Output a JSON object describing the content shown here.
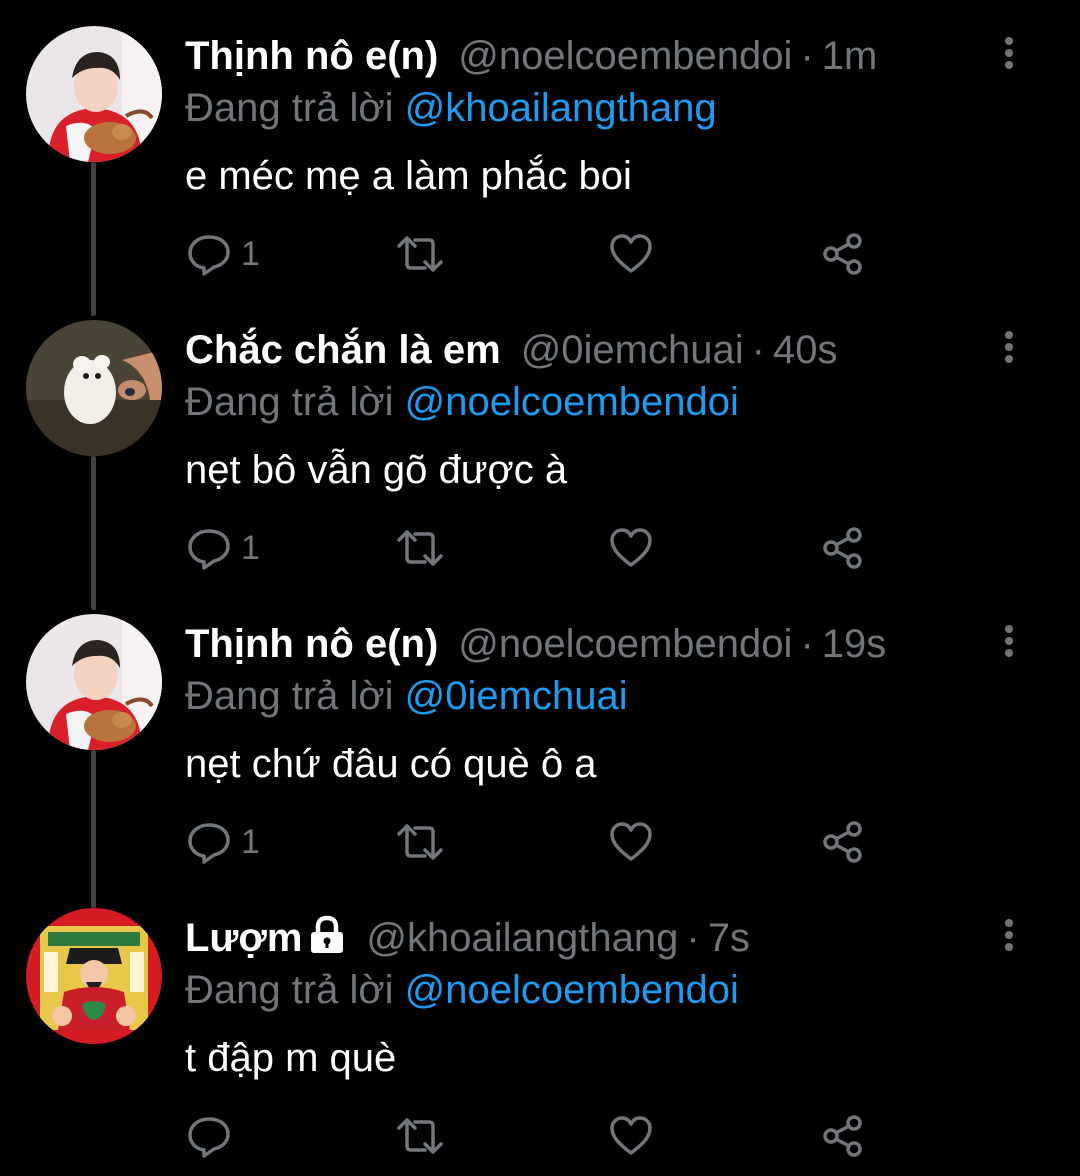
{
  "tweets": [
    {
      "display_name": "Thịnh nô e(n)",
      "handle": "@noelcoembendoi",
      "separator": "·",
      "time": "1m",
      "reply_prefix": "Đang trả lời",
      "reply_to": "@khoailangthang",
      "text": "e méc mẹ a làm phắc boi",
      "reply_count": "1",
      "avatar": "avatar-boy-red-costume",
      "protected": false
    },
    {
      "display_name": "Chắc chắn là em",
      "handle": "@0iemchuai",
      "separator": "·",
      "time": "40s",
      "reply_prefix": "Đang trả lời",
      "reply_to": "@noelcoembendoi",
      "text": "nẹt bô vẫn gõ được à",
      "reply_count": "1",
      "avatar": "avatar-hamster",
      "protected": false
    },
    {
      "display_name": "Thịnh nô e(n)",
      "handle": "@noelcoembendoi",
      "separator": "·",
      "time": "19s",
      "reply_prefix": "Đang trả lời",
      "reply_to": "@0iemchuai",
      "text": "nẹt chứ đâu có què ô a",
      "reply_count": "1",
      "avatar": "avatar-boy-red-costume",
      "protected": false
    },
    {
      "display_name": "Lượm",
      "handle": "@khoailangthang",
      "separator": "·",
      "time": "7s",
      "reply_prefix": "Đang trả lời",
      "reply_to": "@noelcoembendoi",
      "text": "t đập m què",
      "reply_count": "",
      "avatar": "avatar-god-of-wealth",
      "protected": true
    }
  ],
  "icons": {
    "more": "more-vertical-icon",
    "reply": "reply-bubble-icon",
    "retweet": "retweet-icon",
    "like": "heart-icon",
    "share": "share-icon",
    "lock": "lock-icon"
  },
  "colors": {
    "background": "#000000",
    "primary_text": "#ffffff",
    "secondary_text": "#71767b",
    "mention": "#1d9bf0",
    "thread_line": "#3d4145"
  }
}
